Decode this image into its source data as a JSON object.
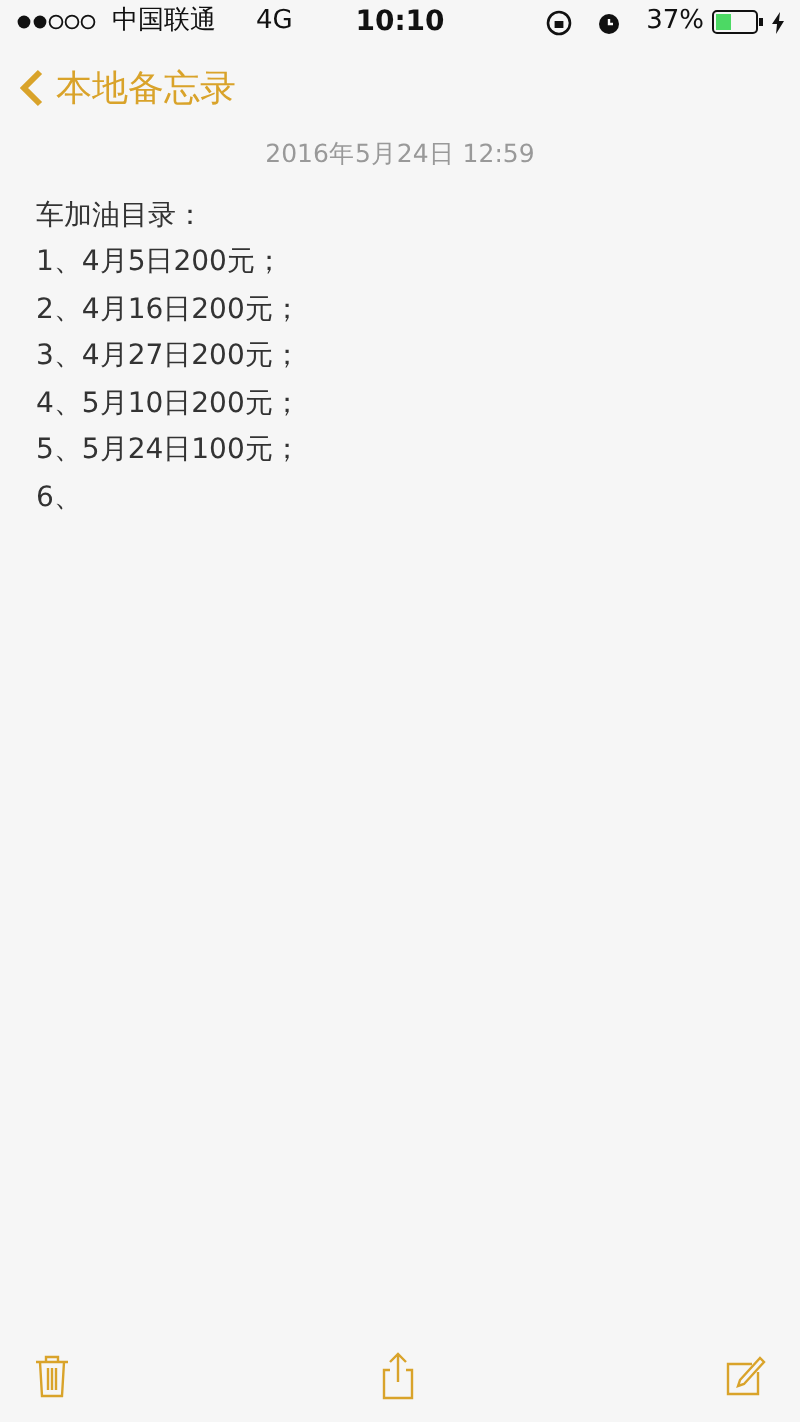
{
  "status_bar": {
    "carrier": "中国联通",
    "network": "4G",
    "time": "10:10",
    "battery_percent": "37%"
  },
  "nav": {
    "back_label": "本地备忘录"
  },
  "note": {
    "date": "2016年5月24日 12:59",
    "lines": [
      "车加油目录：",
      "1、4月5日200元；",
      "2、4月16日200元；",
      "3、4月27日200元；",
      "4、5月10日200元；",
      "5、5月24日100元；",
      "6、"
    ]
  },
  "toolbar": {
    "buttons": [
      {
        "kind": "trash"
      },
      {
        "kind": "share"
      },
      {
        "kind": "compose"
      }
    ]
  }
}
